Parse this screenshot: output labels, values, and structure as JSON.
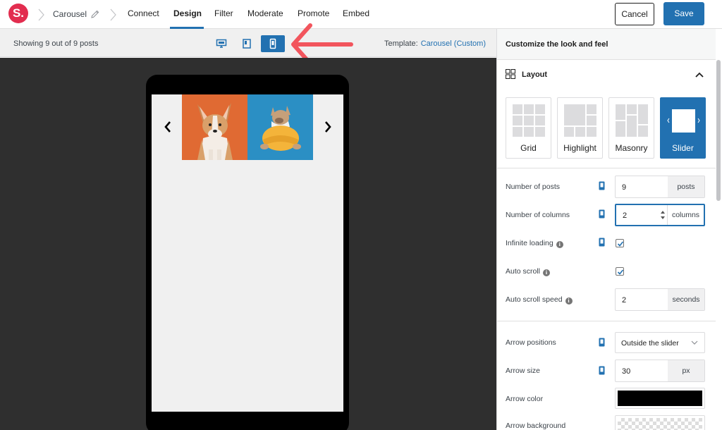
{
  "header": {
    "logo": "S.",
    "breadcrumb": "Carousel",
    "nav": [
      "Connect",
      "Design",
      "Filter",
      "Moderate",
      "Promote",
      "Embed"
    ],
    "active_nav": "Design",
    "cancel_label": "Cancel",
    "save_label": "Save"
  },
  "toolbar": {
    "showing": "Showing 9 out of 9 posts",
    "devices": [
      "desktop-icon",
      "tablet-icon",
      "mobile-icon"
    ],
    "active_device": "mobile",
    "template_label": "Template:",
    "template_value": "Carousel (Custom)"
  },
  "preview": {
    "images": [
      "corgi-on-orange",
      "french-bulldog-on-blue"
    ],
    "prev_icon": "chevron-left-icon",
    "next_icon": "chevron-right-icon"
  },
  "panel": {
    "header": "Customize the look and feel",
    "section": "Layout",
    "layouts": [
      {
        "label": "Grid",
        "icon": "grid-layout-icon"
      },
      {
        "label": "Highlight",
        "icon": "highlight-layout-icon"
      },
      {
        "label": "Masonry",
        "icon": "masonry-layout-icon"
      },
      {
        "label": "Slider",
        "icon": "slider-layout-icon"
      }
    ],
    "active_layout": "Slider",
    "settings": {
      "num_posts": {
        "label": "Number of posts",
        "value": "9",
        "unit": "posts"
      },
      "num_columns": {
        "label": "Number of columns",
        "value": "2",
        "unit": "columns"
      },
      "infinite_loading": {
        "label": "Infinite loading",
        "checked": true
      },
      "auto_scroll": {
        "label": "Auto scroll",
        "checked": true
      },
      "auto_scroll_speed": {
        "label": "Auto scroll speed",
        "value": "2",
        "unit": "seconds"
      },
      "arrow_positions": {
        "label": "Arrow positions",
        "value": "Outside the slider"
      },
      "arrow_size": {
        "label": "Arrow size",
        "value": "30",
        "unit": "px"
      },
      "arrow_color": {
        "label": "Arrow color",
        "value": "#000000"
      },
      "arrow_background": {
        "label": "Arrow background",
        "value": "transparent"
      }
    }
  },
  "colors": {
    "accent": "#2271b1",
    "brand": "#e22d4f",
    "annotation": "#f2555d",
    "preview_bg": "#2f2f2f"
  }
}
